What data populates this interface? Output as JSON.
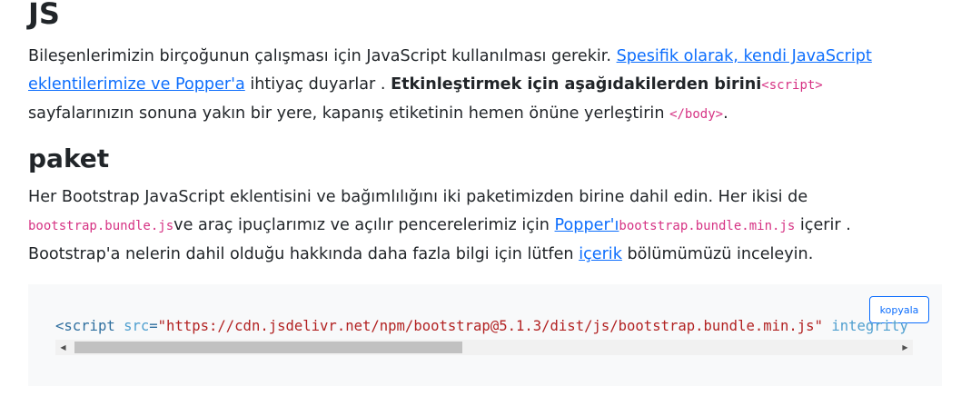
{
  "js_section": {
    "heading": "JS",
    "p1_text1": "Bileşenlerimizin birçoğunun çalışması için JavaScript kullanılması gerekir. ",
    "p1_link": "Spesifik olarak, kendi JavaScript eklentilerimize ve Popper'a",
    "p1_text2": " ihtiyaç duyarlar . ",
    "p1_bold": "Etkinleştirmek için aşağıdakilerden birini",
    "p1_code": "<script>",
    "p1_text3": " sayfalarınızın sonuna yakın bir yere, kapanış etiketinin hemen önüne yerleştirin ",
    "p1_code2": "</body>",
    "p1_text4": "."
  },
  "paket_section": {
    "heading": "paket",
    "p2_text1": "Her Bootstrap JavaScript eklentisini ve bağımlılığını iki paketimizden birine dahil edin. Her ikisi de ",
    "p2_code1": "bootstrap.bundle.js",
    "p2_text2": "ve araç ipuçlarımız ve açılır pencerelerimiz için ",
    "p2_link1": "Popper'ı",
    "p2_code2": "bootstrap.bundle.min.js",
    "p2_text3": " içerir . Bootstrap'a nelerin dahil olduğu hakkında daha fazla bilgi için lütfen ",
    "p2_link2": "içerik",
    "p2_text4": " bölümümüzü inceleyin."
  },
  "code_block": {
    "copy_label": "kopyala",
    "tok_open": "<script",
    "tok_attr_src": " src",
    "tok_eq": "=",
    "tok_src_value": "\"https://cdn.jsdelivr.net/npm/bootstrap@5.1.3/dist/js/bootstrap.bundle.min.js\"",
    "tok_attr_integrity": " integrity"
  },
  "scrollbar": {
    "left_arrow": "◀",
    "right_arrow": "▶"
  }
}
